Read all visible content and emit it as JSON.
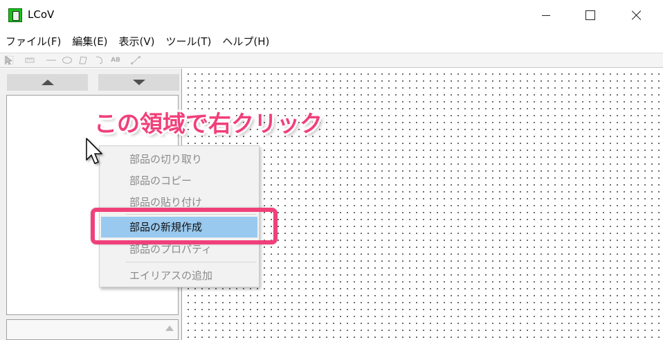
{
  "window": {
    "title": "LCoV",
    "icon": "lcov-app-icon"
  },
  "menubar": {
    "items": [
      "ファイル(F)",
      "編集(E)",
      "表示(V)",
      "ツール(T)",
      "ヘルプ(H)"
    ]
  },
  "toolbar": {
    "icons": [
      "select-icon",
      "ruler-icon",
      "line-icon",
      "ellipse-icon",
      "polygon-icon",
      "arc-icon",
      "text-icon",
      "resize-icon"
    ],
    "text_icon_label": "AB"
  },
  "left_panel": {
    "up_button": "scroll-up",
    "down_button": "scroll-down"
  },
  "context_menu": {
    "items": [
      {
        "label": "部品の切り取り",
        "enabled": false
      },
      {
        "label": "部品のコピー",
        "enabled": false
      },
      {
        "label": "部品の貼り付け",
        "enabled": false
      },
      {
        "label": "部品の新規作成",
        "enabled": true,
        "highlighted": true
      },
      {
        "label": "部品のプロパティ",
        "enabled": false
      },
      {
        "label": "エイリアスの追加",
        "enabled": false
      }
    ]
  },
  "annotation": {
    "text": "この領域で右クリック",
    "color": "#f0407a"
  },
  "colors": {
    "highlight": "#99c9ef",
    "frame": "#f0407a"
  }
}
